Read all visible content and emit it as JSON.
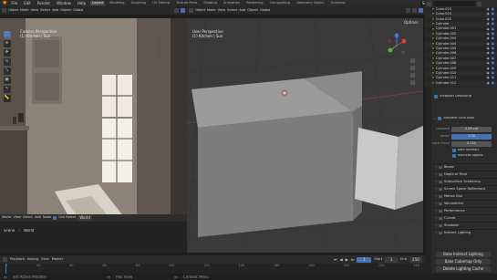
{
  "menu": {
    "items": [
      "File",
      "Edit",
      "Render",
      "Window",
      "Help"
    ],
    "workspaces": [
      "Layout",
      "Modeling",
      "Sculpting",
      "UV Editing",
      "Texture Paint",
      "Shading",
      "Animation",
      "Rendering",
      "Compositing",
      "Geometry Nodes",
      "Scripting"
    ],
    "active_workspace": "Layout",
    "scene": "Scene",
    "view_layer": "View Layer"
  },
  "left_viewport": {
    "mode": "Object Mode",
    "view": "View",
    "select": "Select",
    "add": "Add",
    "object": "Object",
    "transform": "Global",
    "options": "Options",
    "label_line1": "Camera Perspective",
    "label_line2": "(1) Kitchen | Sun",
    "bottom_view": "View",
    "bottom_select": "Select",
    "bottom_add": "Add",
    "bottom_node": "Node",
    "use_nodes": "Use Nodes",
    "slot": "World",
    "scene_label": "Scene",
    "world_label": "World"
  },
  "right_viewport": {
    "mode": "Object Mode",
    "view": "View",
    "select": "Select",
    "add": "Add",
    "object": "Object",
    "transform": "Global",
    "options": "Options",
    "label_line1": "User Perspective",
    "label_line2": "(1) Kitchen | Sun"
  },
  "outliner": {
    "rows": [
      "Cube.023",
      "Cube.024",
      "Cube.025",
      "Cylinder",
      "Cylinder.001",
      "Cylinder.002",
      "Cylinder.003",
      "Cylinder.004",
      "Cylinder.005",
      "Cylinder.006",
      "Cylinder.007",
      "Cylinder.008",
      "Cylinder.009",
      "Cylinder.010",
      "Cylinder.011",
      "Cylinder.012"
    ]
  },
  "properties": {
    "viewport_denoising": "Viewport Denoising",
    "ambient_occlusion": "Ambient Occlusion",
    "distance_label": "Distance",
    "distance_value": "0.28 cm",
    "factor_label": "Factor",
    "factor_value": "1.00",
    "trace_label": "Trace Precis...",
    "trace_value": "0.250",
    "bent_normals": "Bent Normals",
    "bounces": "Bounces Approx...",
    "sections": [
      "Bloom",
      "Depth of Field",
      "Subsurface Scattering",
      "Screen Space Reflections",
      "Motion Blur",
      "Volumetrics",
      "Performance",
      "Curves",
      "Shadows",
      "Indirect Lighting"
    ],
    "bake_button": "Bake Indirect Lighting",
    "bake_cubemap": "Bake Cubemap Only",
    "delete_lighting": "Delete Lighting Cache"
  },
  "timeline": {
    "playback": "Playback",
    "keying": "Keying",
    "view": "View",
    "marker": "Marker",
    "current_frame": "1",
    "start_label": "Start",
    "start_value": "1",
    "end_label": "End",
    "end_value": "250",
    "ruler": [
      "0",
      "20",
      "40",
      "60",
      "80",
      "100",
      "120",
      "140",
      "160",
      "180",
      "200",
      "220",
      "240"
    ]
  },
  "statusbar": {
    "select": "Set Active Modifier",
    "pan": "Pan View",
    "context": "Context Menu"
  },
  "colors": {
    "accent": "#4772b3",
    "active_object": "#e0a020"
  }
}
